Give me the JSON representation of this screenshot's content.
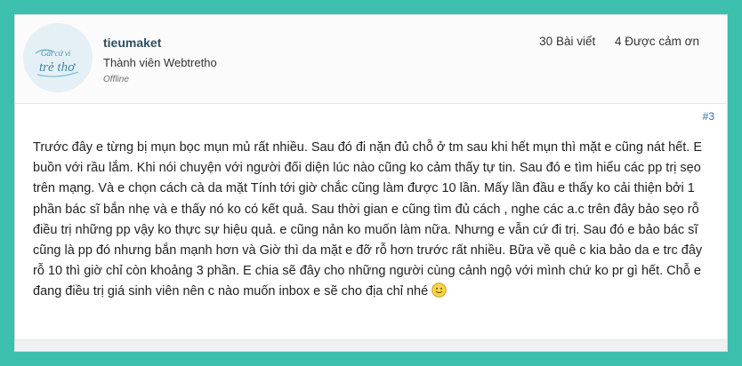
{
  "user": {
    "name": "tieumaket",
    "rank": "Thành viên Webtretho",
    "status": "Offline",
    "avatar_lines": [
      "Gắt cứ vi",
      "trẻ thơ"
    ]
  },
  "stats": {
    "posts": "30 Bài viết",
    "thanks": "4 Được cảm ơn"
  },
  "post": {
    "number": "#3",
    "body": "Trước đây e từng bị mụn bọc mụn mủ rất nhiều. Sau đó đi nặn đủ chỗ ở tm sau khi hết mụn thì mặt e cũng nát hết. E buồn với rầu lắm. Khi nói chuyện với người đối diện lúc nào cũng ko cảm thấy tự tin. Sau đó e tìm hiểu các pp trị sẹo trên mạng. Và e chọn cách cà da mặt Tính tới giờ chắc cũng làm được 10 lần. Mấy lần đầu e thấy ko cải thiện bởi 1 phần bác sĩ bắn nhẹ và e thấy nó ko có kết quả. Sau thời gian e cũng tìm đủ cách , nghe các a.c trên đây bảo sẹo rỗ điều trị những pp vậy ko thực sự hiệu quả. e cũng nản ko muốn làm nữa. Nhưng e vẫn cứ đi trị. Sau đó e bảo bác sĩ cũng là pp đó nhưng bắn mạnh hơn và Giờ thì da mặt e đỡ rỗ hơn trước rất nhiều. Bữa về quê c kia bảo da e trc đây rỗ 10 thì giờ chỉ còn khoảng 3 phần. E chia sẽ đây cho những người cùng cảnh ngộ với mình chứ ko pr gì hết. Chỗ e đang điều trị giá sinh viên nên c nào muốn inbox e sẽ cho địa chỉ nhé",
    "emoticon": "smile-icon"
  },
  "colors": {
    "background": "#3dbfae",
    "username": "#2f4e5e",
    "link": "#2a6ea6"
  }
}
